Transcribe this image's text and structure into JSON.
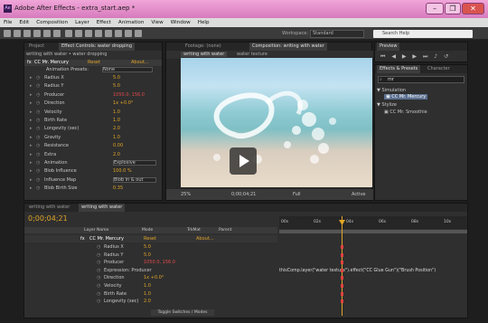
{
  "window": {
    "title": "Adobe After Effects - extra_start.aep *",
    "app_icon": "Ae",
    "minimize": "–",
    "restore": "❐",
    "close": "✕"
  },
  "menu": [
    "File",
    "Edit",
    "Composition",
    "Layer",
    "Effect",
    "Animation",
    "View",
    "Window",
    "Help"
  ],
  "toolbar": {
    "workspace_label": "Workspace:",
    "workspace_value": "Standard",
    "search_placeholder": "Search Help"
  },
  "effect_controls": {
    "tabs": [
      "Project",
      "Effect Controls: water dropping"
    ],
    "breadcrumb": "writing with water • water dropping",
    "effect_name": "CC Mr. Mercury",
    "reset": "Reset",
    "about": "About...",
    "animation_presets_label": "Animation Presets:",
    "animation_presets_value": "None",
    "rows": [
      {
        "label": "Radius X",
        "value": "5.0",
        "color": "yellow"
      },
      {
        "label": "Radius Y",
        "value": "5.0",
        "color": "yellow"
      },
      {
        "label": "Producer",
        "value": "1050.0, 156.0",
        "color": "red"
      },
      {
        "label": "Direction",
        "value": "1x +0.0°",
        "color": "yellow"
      },
      {
        "label": "Velocity",
        "value": "1.0",
        "color": "yellow"
      },
      {
        "label": "Birth Rate",
        "value": "1.0",
        "color": "yellow"
      },
      {
        "label": "Longevity (sec)",
        "value": "2.0",
        "color": "yellow"
      },
      {
        "label": "Gravity",
        "value": "1.0",
        "color": "yellow"
      },
      {
        "label": "Resistance",
        "value": "0.00",
        "color": "yellow"
      },
      {
        "label": "Extra",
        "value": "2.0",
        "color": "yellow"
      },
      {
        "label": "Animation",
        "value": "Explosive",
        "color": "plain"
      },
      {
        "label": "Blob Influence",
        "value": "100.0 %",
        "color": "yellow"
      },
      {
        "label": "Influence Map",
        "value": "Blob in & out",
        "color": "plain"
      },
      {
        "label": "Blob Birth Size",
        "value": "0.35",
        "color": "yellow"
      }
    ]
  },
  "footage_tab": "Footage: (none)",
  "composition": {
    "tab": "Composition: writing with water",
    "subtabs": [
      "writing with water",
      "water texture"
    ],
    "zoom": "25%",
    "timecode": "0;00;04;21",
    "resolution": "Full",
    "active": "Active"
  },
  "preview": {
    "tab": "Preview"
  },
  "effects_presets": {
    "tabs": [
      "Effects & Presets",
      "Character"
    ],
    "search_value": "mr",
    "simulation": "Simulation",
    "simulation_item": "CC Mr. Mercury",
    "stylize": "Stylize",
    "stylize_item": "CC Mr. Smoothie"
  },
  "timeline": {
    "tabs": [
      "writing with water",
      "writing with water"
    ],
    "timecode": "0;00;04;21",
    "headers": {
      "layer_name": "Layer Name",
      "mode": "Mode",
      "trkmat": "TrkMat",
      "parent": "Parent"
    },
    "ruler": [
      "00s",
      "02s",
      "04s",
      "06s",
      "08s",
      "10s"
    ],
    "effect_name": "CC Mr. Mercury",
    "reset": "Reset",
    "about": "About...",
    "rows": [
      {
        "label": "Radius X",
        "value": "5.0",
        "color": "yellow"
      },
      {
        "label": "Radius Y",
        "value": "5.0",
        "color": "yellow"
      },
      {
        "label": "Producer",
        "value": "1050.0, 156.0",
        "color": "red"
      },
      {
        "label": "Expression: Producer",
        "value": "",
        "color": "plain"
      },
      {
        "label": "Direction",
        "value": "1x +0.0°",
        "color": "yellow"
      },
      {
        "label": "Velocity",
        "value": "1.0",
        "color": "yellow"
      },
      {
        "label": "Birth Rate",
        "value": "1.0",
        "color": "yellow"
      },
      {
        "label": "Longevity (sec)",
        "value": "2.0",
        "color": "yellow"
      }
    ],
    "expression": "thisComp.layer(\"water texture\").effect(\"CC Glue Gun\")(\"Brush Position\")",
    "toggle": "Toggle Switches / Modes"
  }
}
